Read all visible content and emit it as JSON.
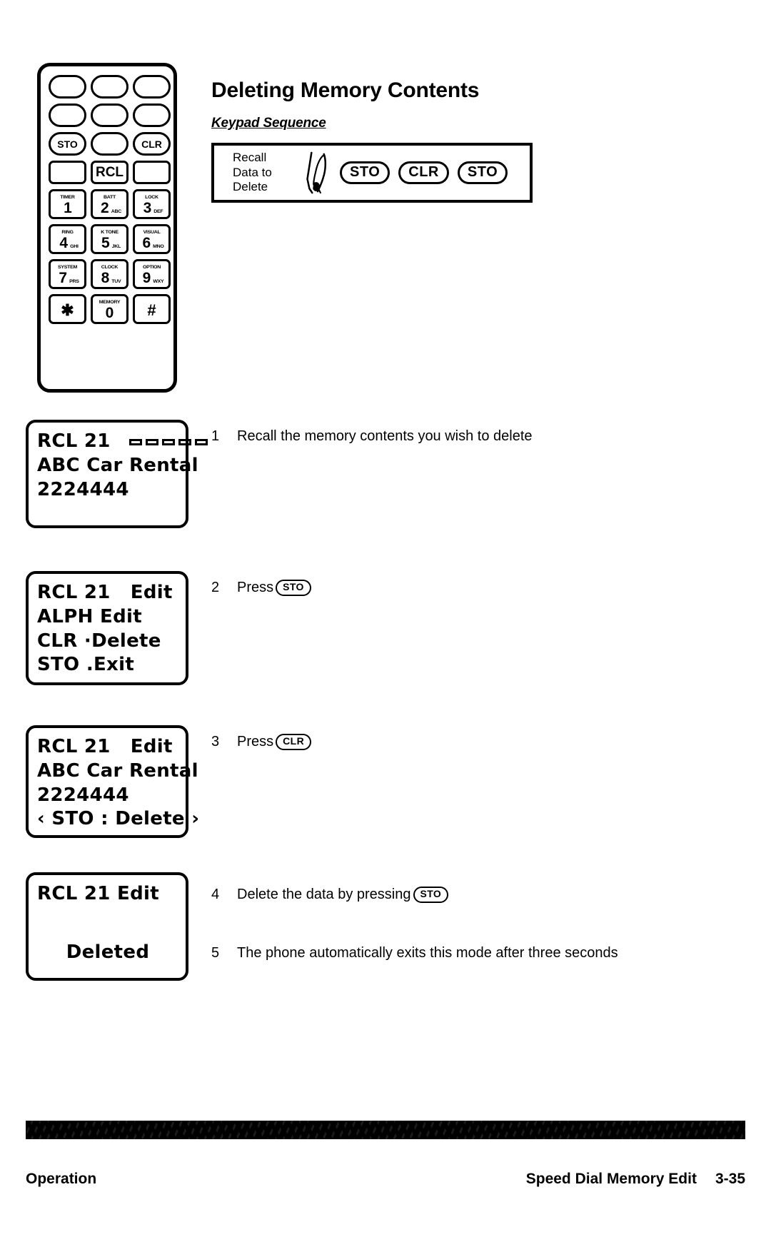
{
  "page": {
    "title": "Deleting Memory Contents",
    "keypad_sequence_label": "Keypad Sequence"
  },
  "phone": {
    "keys": [
      {
        "type": "blank-oval",
        "label": ""
      },
      {
        "type": "blank-oval",
        "label": ""
      },
      {
        "type": "blank-oval",
        "label": ""
      },
      {
        "type": "blank-oval",
        "label": ""
      },
      {
        "type": "blank-oval",
        "label": ""
      },
      {
        "type": "blank-oval",
        "label": ""
      },
      {
        "type": "oval",
        "label": "STO"
      },
      {
        "type": "blank-oval",
        "label": ""
      },
      {
        "type": "oval",
        "label": "CLR"
      },
      {
        "type": "blank-square",
        "label": ""
      },
      {
        "type": "square",
        "label": "RCL"
      },
      {
        "type": "blank-square",
        "label": ""
      }
    ],
    "numeric_keys": [
      {
        "top": "TIMER",
        "digit": "1",
        "letters": ""
      },
      {
        "top": "BATT",
        "digit": "2",
        "letters": "ABC"
      },
      {
        "top": "LOCK",
        "digit": "3",
        "letters": "DEF"
      },
      {
        "top": "RING",
        "digit": "4",
        "letters": "GHI"
      },
      {
        "top": "K TONE",
        "digit": "5",
        "letters": "JKL"
      },
      {
        "top": "VISUAL",
        "digit": "6",
        "letters": "MNO"
      },
      {
        "top": "SYSTEM",
        "digit": "7",
        "letters": "PRS"
      },
      {
        "top": "CLOCK",
        "digit": "8",
        "letters": "TUV"
      },
      {
        "top": "OPTION",
        "digit": "9",
        "letters": "WXY"
      },
      {
        "top": "",
        "digit": "✱",
        "letters": ""
      },
      {
        "top": "MEMORY",
        "digit": "0",
        "letters": ""
      },
      {
        "top": "",
        "digit": "#",
        "letters": ""
      }
    ]
  },
  "sequence_box": {
    "caption_line_1": "Recall",
    "caption_line_2": "Data to",
    "caption_line_3": "Delete",
    "keys": [
      "STO",
      "CLR",
      "STO"
    ]
  },
  "lcd_screens": [
    {
      "id": "lcd-1",
      "line_1": "RCL 21",
      "signal_bars": 5,
      "line_2": "ABC Car Rental",
      "line_3": "2224444"
    },
    {
      "id": "lcd-2",
      "line_1": "RCL 21   Edit",
      "line_2": "ALPH Edit",
      "line_3": "CLR ·Delete",
      "line_4": "STO .Exit"
    },
    {
      "id": "lcd-3",
      "line_1": "RCL 21   Edit",
      "line_2": "ABC Car Rental",
      "line_3": "2224444",
      "line_4": "‹ STO : Delete ›"
    },
    {
      "id": "lcd-4",
      "line_1": "RCL 21 Edit",
      "line_2": "Deleted"
    }
  ],
  "steps": [
    {
      "number": "1",
      "text": "Recall the memory contents you wish to delete",
      "key": ""
    },
    {
      "number": "2",
      "text": "Press",
      "key": "STO"
    },
    {
      "number": "3",
      "text": "Press",
      "key": "CLR"
    },
    {
      "number": "4",
      "text": "Delete the data by pressing",
      "key": "STO"
    },
    {
      "number": "5",
      "text": "The phone automatically exits this mode after three seconds",
      "key": ""
    }
  ],
  "footer": {
    "left": "Operation",
    "section": "Speed Dial Memory Edit",
    "page_number": "3-35"
  }
}
